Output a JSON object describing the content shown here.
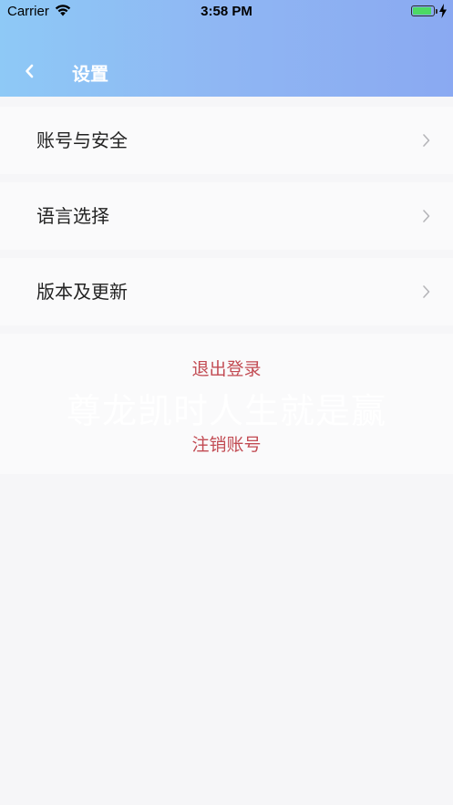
{
  "status_bar": {
    "carrier": "Carrier",
    "time": "3:58 PM",
    "wifi_icon": "wifi-icon",
    "battery_icon": "battery-icon",
    "charging_icon": "lightning-icon",
    "battery_color": "#4cd964"
  },
  "nav": {
    "title": "设置",
    "back_icon": "chevron-left-icon"
  },
  "settings": {
    "items": [
      {
        "label": "账号与安全",
        "icon": "chevron-right-icon"
      },
      {
        "label": "语言选择",
        "icon": "chevron-right-icon"
      },
      {
        "label": "版本及更新",
        "icon": "chevron-right-icon"
      }
    ]
  },
  "actions": {
    "logout": "退出登录",
    "deactivate": "注销账号",
    "color": "#c24b53"
  },
  "watermark": "尊龙凯时人生就是赢",
  "colors": {
    "header_start": "#8ec9f6",
    "header_end": "#8aa9f2",
    "background": "#f6f6f8"
  }
}
